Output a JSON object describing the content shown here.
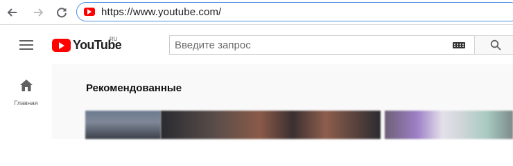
{
  "browser": {
    "url": "https://www.youtube.com/",
    "icons": [
      "back-arrow-icon",
      "forward-arrow-icon",
      "reload-icon",
      "youtube-favicon"
    ]
  },
  "masthead": {
    "logo_text": "YouTube",
    "region": "RU",
    "search_placeholder": "Введите запрос",
    "icons": [
      "hamburger-menu-icon",
      "keyboard-icon",
      "search-icon"
    ]
  },
  "guide": {
    "home_label": "Главная",
    "icons": [
      "home-icon"
    ]
  },
  "main": {
    "section_title": "Рекомендованные"
  },
  "colors": {
    "brand_red": "#ff0000",
    "address_focus": "#4a90e2",
    "content_bg": "#f9f9f9"
  }
}
